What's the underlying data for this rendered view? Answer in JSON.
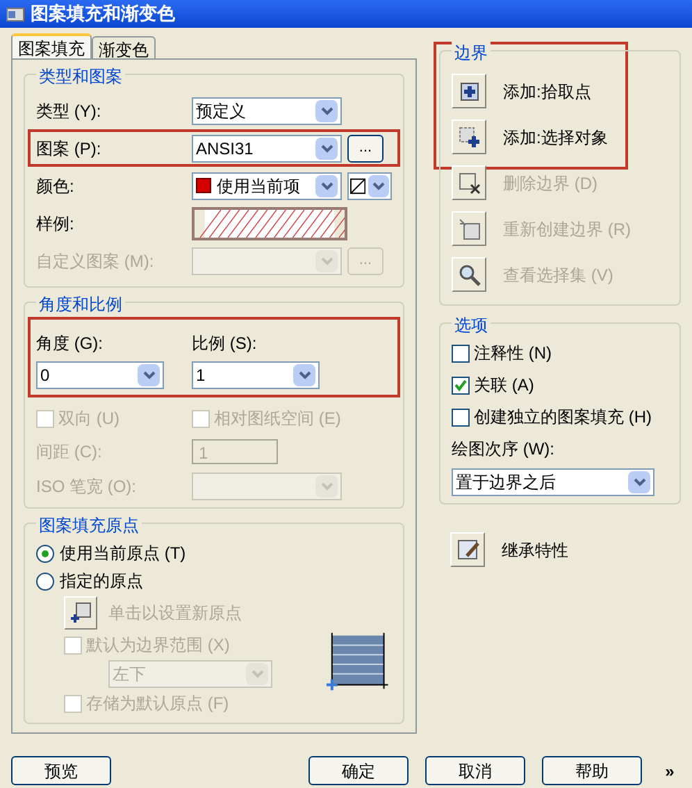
{
  "window": {
    "title": "图案填充和渐变色"
  },
  "tabs": [
    {
      "label": "图案填充",
      "selected": true
    },
    {
      "label": "渐变色",
      "selected": false
    }
  ],
  "type_and_pattern": {
    "title": "类型和图案",
    "rows": [
      {
        "kind": "dropdown",
        "label": "类型 (Y):",
        "value": "预定义",
        "disabled": false,
        "highlighted": false
      },
      {
        "kind": "dropdown",
        "label": "图案 (P):",
        "value": "ANSI31",
        "browse": "...",
        "disabled": false,
        "highlighted": true
      },
      {
        "kind": "color",
        "label": "颜色:",
        "value": "使用当前项",
        "disabled": false,
        "highlighted": false
      },
      {
        "kind": "sample",
        "label": "样例:",
        "disabled": false,
        "highlighted": false
      },
      {
        "kind": "dropdown",
        "label": "自定义图案 (M):",
        "browse": "...",
        "disabled": true,
        "highlighted": false
      }
    ]
  },
  "angle_and_scale": {
    "title": "角度和比例",
    "highlighted": true,
    "angle": {
      "label": "角度 (G):",
      "value": "0"
    },
    "scale": {
      "label": "比例 (S):",
      "value": "1"
    },
    "checkboxes": [
      {
        "label": "双向 (U)",
        "checked": false,
        "disabled": true
      },
      {
        "label": "相对图纸空间 (E)",
        "checked": false,
        "disabled": true
      }
    ],
    "spacing": {
      "label": "间距 (C):",
      "value": "1",
      "disabled": true
    },
    "pen_width": {
      "label": "ISO 笔宽 (O):",
      "disabled": true
    }
  },
  "origin": {
    "title": "图案填充原点",
    "radios": [
      {
        "label": "使用当前原点 (T)",
        "selected": true
      },
      {
        "label": "指定的原点",
        "selected": false
      }
    ],
    "set_button": {
      "label": "单击以设置新原点",
      "disabled": true
    },
    "default_extent": {
      "label": "默认为边界范围 (X)",
      "checked": false,
      "disabled": true
    },
    "position": {
      "value": "左下",
      "disabled": true
    },
    "store_default": {
      "label": "存储为默认原点 (F)",
      "checked": false,
      "disabled": true
    }
  },
  "boundary": {
    "title": "边界",
    "buttons": [
      {
        "kind": "pick",
        "label": "添加:拾取点",
        "disabled": false,
        "highlighted": true
      },
      {
        "kind": "select",
        "label": "添加:选择对象",
        "disabled": false,
        "highlighted": true
      },
      {
        "kind": "remove",
        "label": "删除边界 (D)",
        "disabled": true,
        "highlighted": false
      },
      {
        "kind": "recreate",
        "label": "重新创建边界 (R)",
        "disabled": true,
        "highlighted": false
      },
      {
        "kind": "view",
        "label": "查看选择集 (V)",
        "disabled": true,
        "highlighted": false
      }
    ]
  },
  "options": {
    "title": "选项",
    "checkboxes": [
      {
        "label": "注释性 (N)",
        "checked": false
      },
      {
        "label": "关联 (A)",
        "checked": true
      },
      {
        "label": "创建独立的图案填充 (H)",
        "checked": false
      }
    ],
    "draw_order": {
      "label": "绘图次序 (W):",
      "value": "置于边界之后"
    }
  },
  "inherit": {
    "label": "继承特性"
  },
  "footer": {
    "left": [
      "预览"
    ],
    "right": [
      "确定",
      "取消",
      "帮助"
    ],
    "more": "»"
  }
}
